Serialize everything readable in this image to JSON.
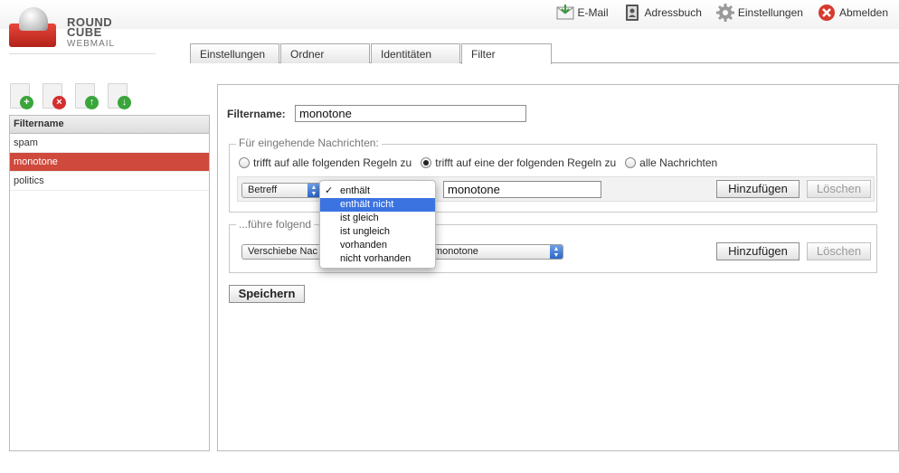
{
  "app": {
    "logo_line1": "ROUND",
    "logo_line2": "CUBE",
    "logo_sub": "WEBMAIL"
  },
  "topnav": [
    {
      "label": "E-Mail",
      "icon": "mail-icon"
    },
    {
      "label": "Adressbuch",
      "icon": "addressbook-icon"
    },
    {
      "label": "Einstellungen",
      "icon": "gear-icon"
    },
    {
      "label": "Abmelden",
      "icon": "logout-icon"
    }
  ],
  "tabs": [
    {
      "label": "Einstellungen"
    },
    {
      "label": "Ordner"
    },
    {
      "label": "Identitäten"
    },
    {
      "label": "Filter",
      "active": true
    }
  ],
  "filter_toolbar": [
    {
      "icon": "add-filter-icon",
      "symbol": "+"
    },
    {
      "icon": "delete-filter-icon",
      "symbol": "×"
    },
    {
      "icon": "move-up-icon",
      "symbol": "↑"
    },
    {
      "icon": "move-down-icon",
      "symbol": "↓"
    }
  ],
  "filterlist": {
    "header": "Filtername",
    "items": [
      {
        "name": "spam"
      },
      {
        "name": "monotone",
        "selected": true
      },
      {
        "name": "politics"
      }
    ]
  },
  "form": {
    "filtername_label": "Filtername:",
    "filtername_value": "monotone",
    "incoming": {
      "legend": "Für eingehende Nachrichten:",
      "options": [
        {
          "label": "trifft auf alle folgenden Regeln zu",
          "checked": false
        },
        {
          "label": "trifft auf eine der folgenden Regeln zu",
          "checked": true
        },
        {
          "label": "alle Nachrichten",
          "checked": false
        }
      ],
      "rule": {
        "header_select": "Betreff",
        "value": "monotone",
        "add_label": "Hinzufügen",
        "delete_label": "Löschen"
      }
    },
    "actions": {
      "legend": "...führe folgend",
      "action_select": "Verschiebe Nac",
      "target_select": "monotone",
      "add_label": "Hinzufügen",
      "delete_label": "Löschen"
    },
    "save_label": "Speichern"
  },
  "dropdown": {
    "items": [
      {
        "label": "enthält",
        "checked": true
      },
      {
        "label": "enthält nicht",
        "highlighted": true
      },
      {
        "label": "ist gleich"
      },
      {
        "label": "ist ungleich"
      },
      {
        "label": "vorhanden"
      },
      {
        "label": "nicht vorhanden"
      }
    ],
    "check_mark": "✓"
  },
  "colors": {
    "selected_row": "#d0493d",
    "highlight": "#3b73e0"
  }
}
